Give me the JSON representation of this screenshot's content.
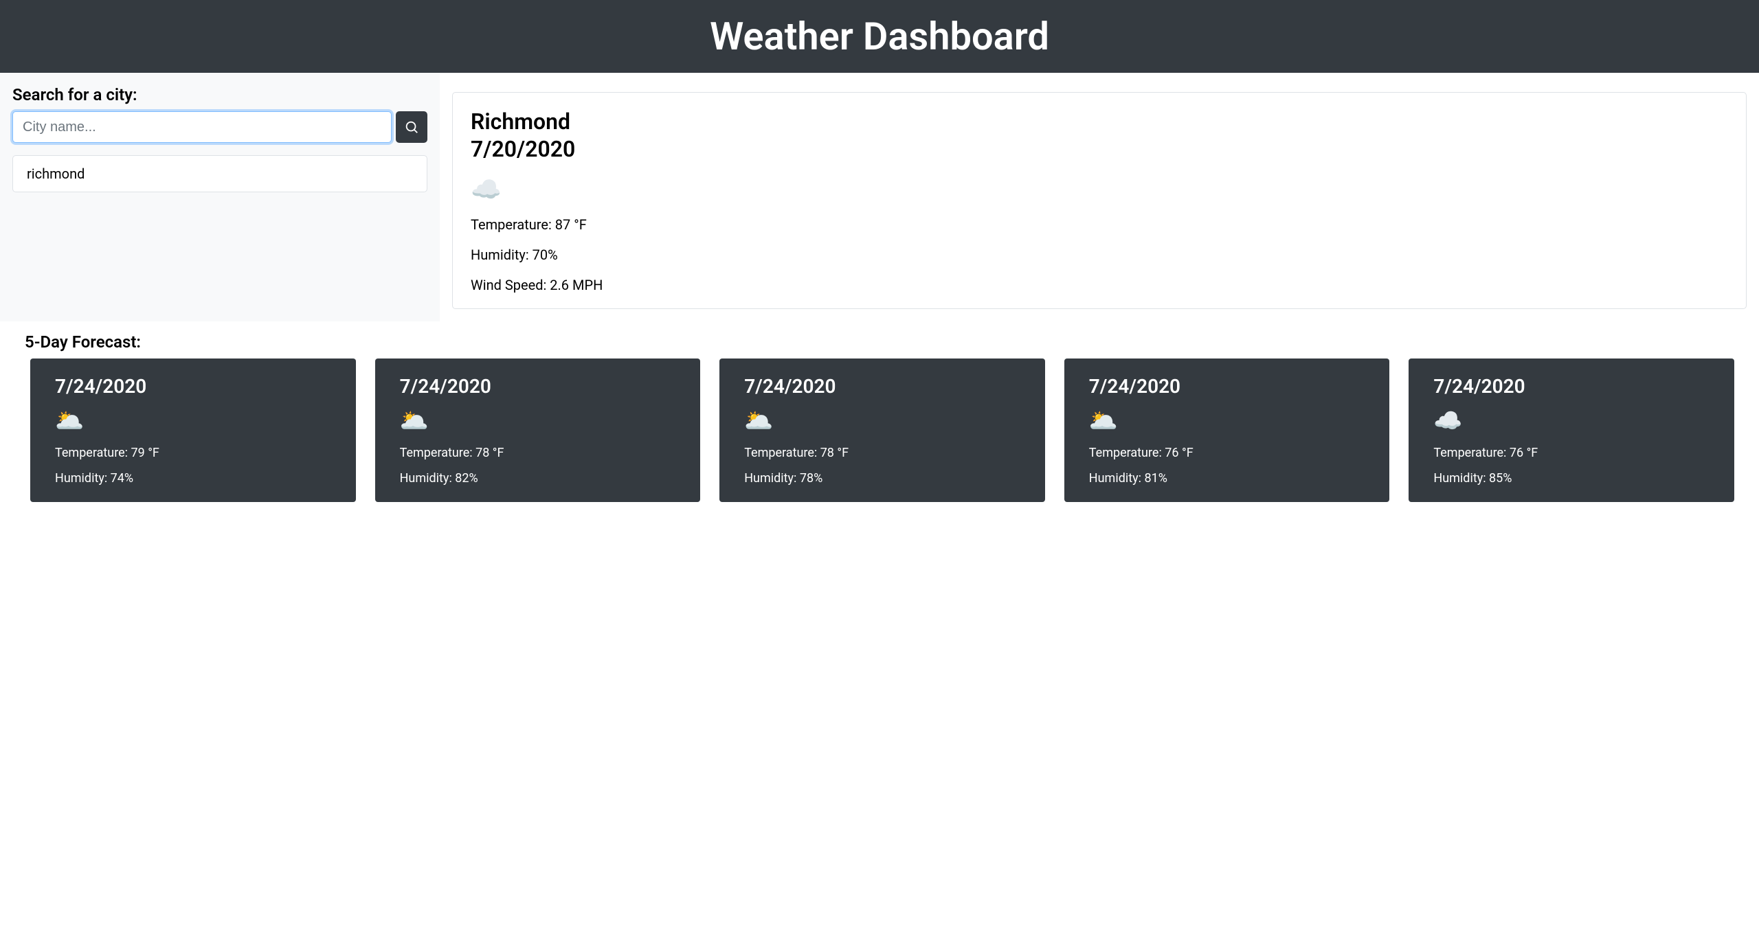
{
  "header": {
    "title": "Weather Dashboard"
  },
  "sidebar": {
    "search_label": "Search for a city:",
    "search_placeholder": "City name...",
    "search_value": "",
    "history": [
      {
        "label": "richmond"
      }
    ]
  },
  "current": {
    "city": "Richmond",
    "date": "7/20/2020",
    "icon": "☁️",
    "temperature_label": "Temperature: 87 °F",
    "humidity_label": "Humidity: 70%",
    "wind_label": "Wind Speed: 2.6 MPH"
  },
  "forecast": {
    "heading": "5-Day Forecast:",
    "days": [
      {
        "date": "7/24/2020",
        "icon": "🌥️",
        "temperature_label": "Temperature: 79 °F",
        "humidity_label": "Humidity: 74%"
      },
      {
        "date": "7/24/2020",
        "icon": "🌥️",
        "temperature_label": "Temperature: 78 °F",
        "humidity_label": "Humidity: 82%"
      },
      {
        "date": "7/24/2020",
        "icon": "🌥️",
        "temperature_label": "Temperature: 78 °F",
        "humidity_label": "Humidity: 78%"
      },
      {
        "date": "7/24/2020",
        "icon": "🌥️",
        "temperature_label": "Temperature: 76 °F",
        "humidity_label": "Humidity: 81%"
      },
      {
        "date": "7/24/2020",
        "icon": "☁️",
        "temperature_label": "Temperature: 76 °F",
        "humidity_label": "Humidity: 85%"
      }
    ]
  }
}
